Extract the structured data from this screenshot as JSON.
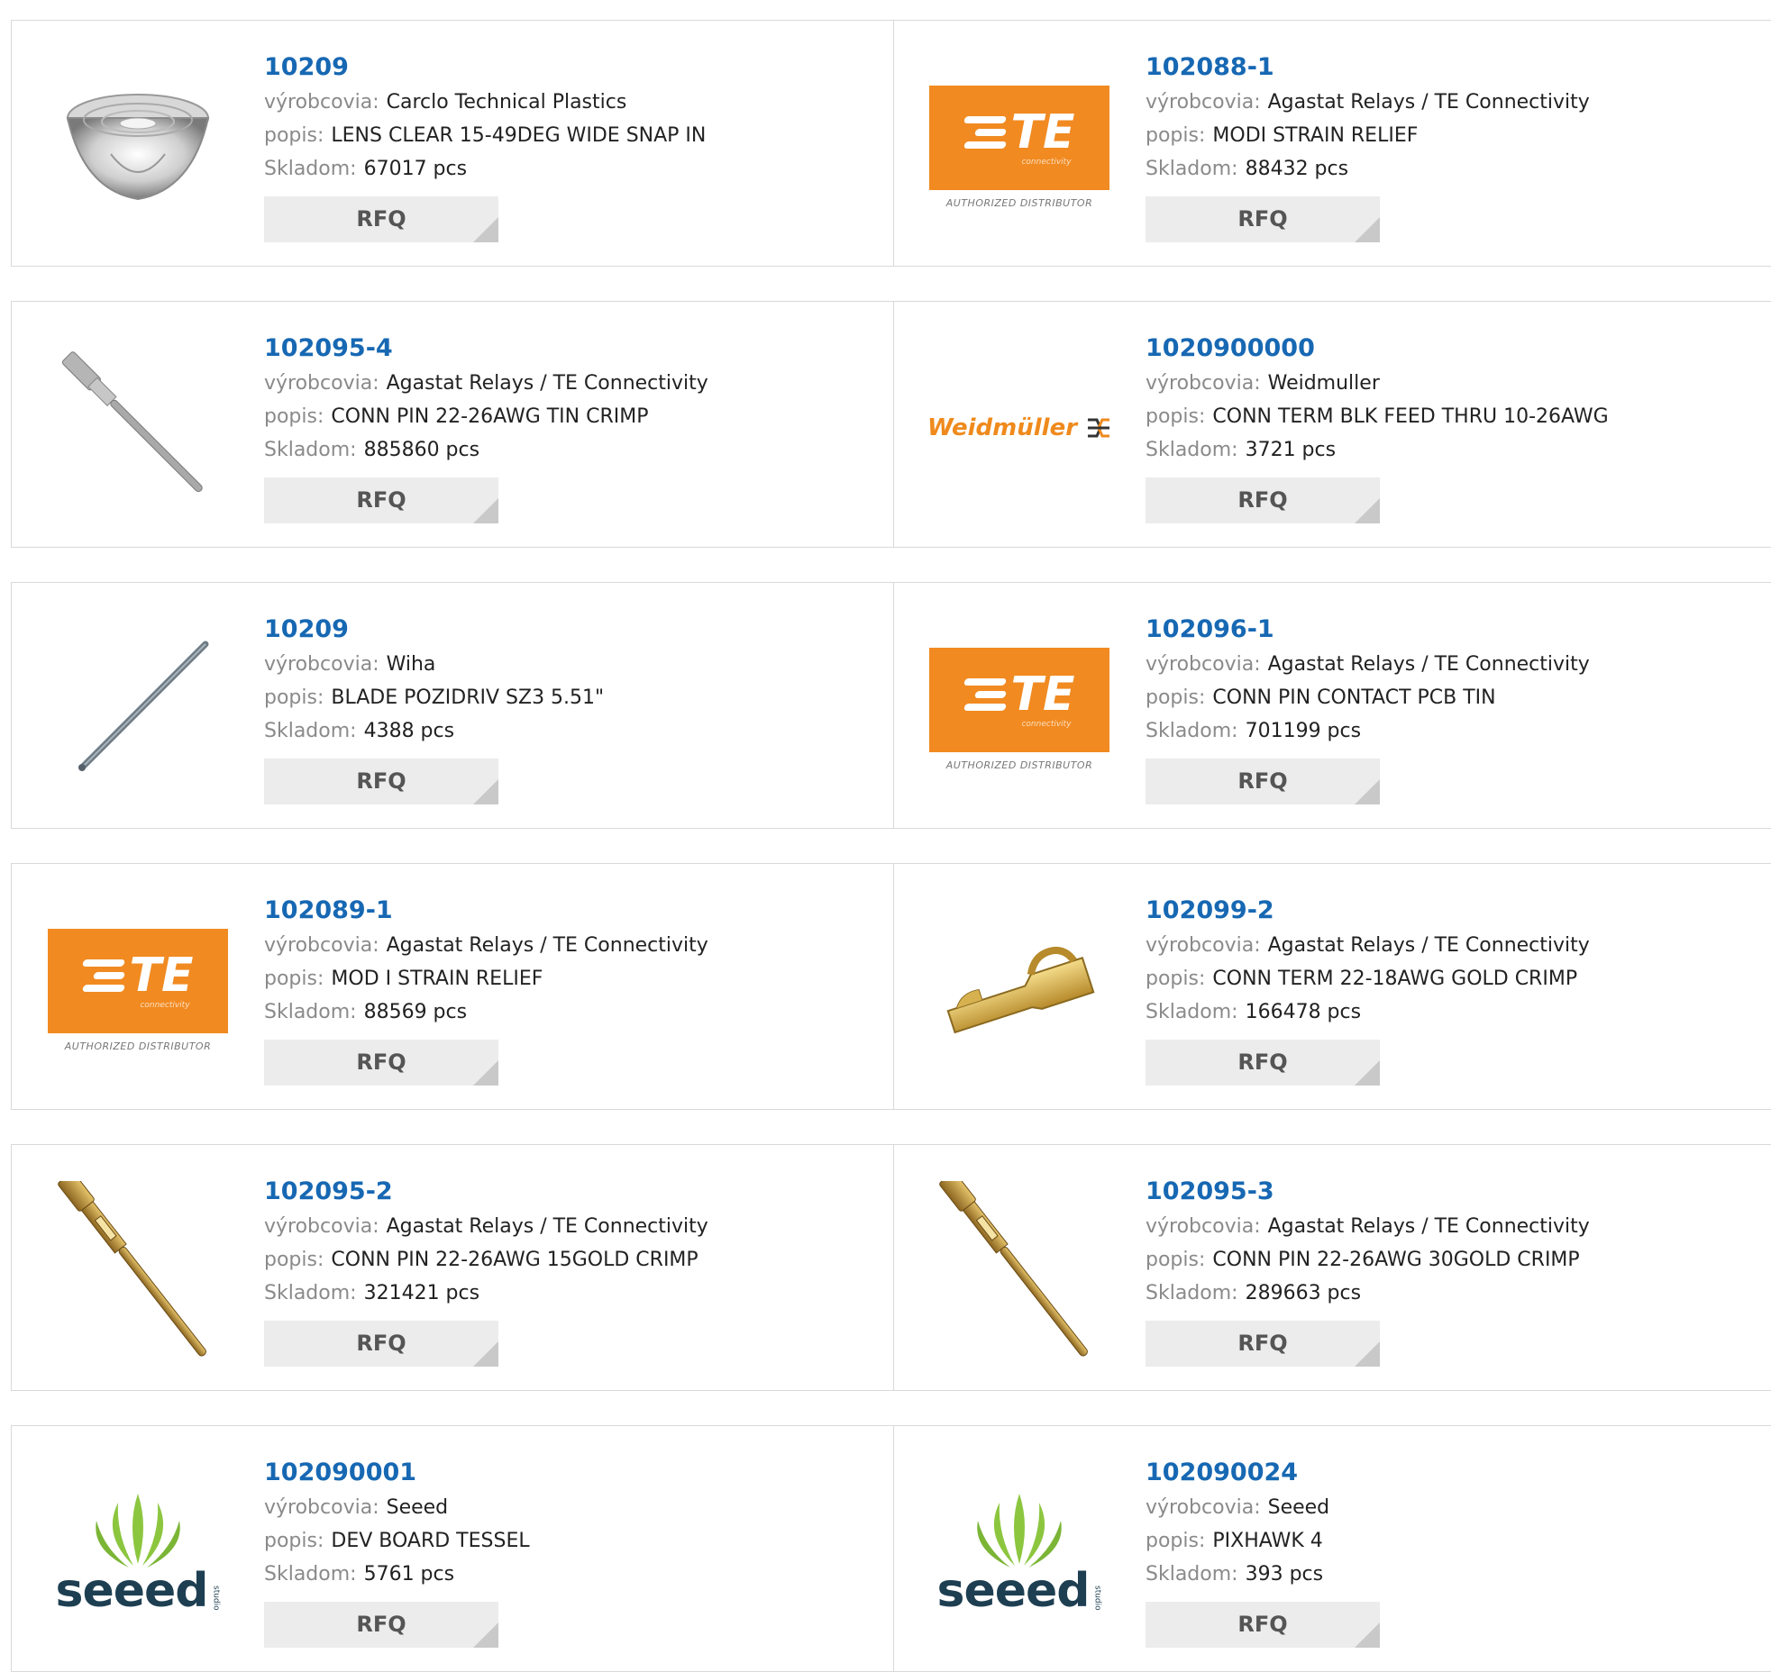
{
  "labels": {
    "manufacturer": "výrobcovia:",
    "description": "popis:",
    "stock": "Skladom:",
    "rfq": "RFQ"
  },
  "colors": {
    "part_link": "#1768b3",
    "te_orange": "#f18a21",
    "seeed_green": "#8cc63f",
    "seeed_navy": "#1e3f52"
  },
  "logos": {
    "te": {
      "name": "TE",
      "sub": "connectivity",
      "tagline": "AUTHORIZED DISTRIBUTOR"
    },
    "weidmuller": {
      "name": "Weidmüller"
    },
    "seeed": {
      "name": "seeed",
      "sub": "studio"
    }
  },
  "products": [
    {
      "part": "10209",
      "manufacturer": "Carclo Technical Plastics",
      "description": "LENS CLEAR 15-49DEG WIDE SNAP IN",
      "stock": "67017 pcs",
      "image": "lens-image"
    },
    {
      "part": "102088-1",
      "manufacturer": "Agastat Relays / TE Connectivity",
      "description": "MODI STRAIN RELIEF",
      "stock": "88432 pcs",
      "image": "te-logo"
    },
    {
      "part": "102095-4",
      "manufacturer": "Agastat Relays / TE Connectivity",
      "description": "CONN PIN 22-26AWG TIN CRIMP",
      "stock": "885860 pcs",
      "image": "silver-pin-image"
    },
    {
      "part": "1020900000",
      "manufacturer": "Weidmuller",
      "description": "CONN TERM BLK FEED THRU 10-26AWG",
      "stock": "3721 pcs",
      "image": "weidmuller-logo"
    },
    {
      "part": "10209",
      "manufacturer": "Wiha",
      "description": "BLADE POZIDRIV SZ3 5.51\"",
      "stock": "4388 pcs",
      "image": "screwdriver-blade-image"
    },
    {
      "part": "102096-1",
      "manufacturer": "Agastat Relays / TE Connectivity",
      "description": "CONN PIN CONTACT PCB TIN",
      "stock": "701199 pcs",
      "image": "te-logo"
    },
    {
      "part": "102089-1",
      "manufacturer": "Agastat Relays / TE Connectivity",
      "description": "MOD I STRAIN RELIEF",
      "stock": "88569 pcs",
      "image": "te-logo"
    },
    {
      "part": "102099-2",
      "manufacturer": "Agastat Relays / TE Connectivity",
      "description": "CONN TERM 22-18AWG GOLD CRIMP",
      "stock": "166478 pcs",
      "image": "gold-terminal-image"
    },
    {
      "part": "102095-2",
      "manufacturer": "Agastat Relays / TE Connectivity",
      "description": "CONN PIN 22-26AWG 15GOLD CRIMP",
      "stock": "321421 pcs",
      "image": "gold-pin-image"
    },
    {
      "part": "102095-3",
      "manufacturer": "Agastat Relays / TE Connectivity",
      "description": "CONN PIN 22-26AWG 30GOLD CRIMP",
      "stock": "289663 pcs",
      "image": "gold-pin-image"
    },
    {
      "part": "102090001",
      "manufacturer": "Seeed",
      "description": "DEV BOARD TESSEL",
      "stock": "5761 pcs",
      "image": "seeed-logo"
    },
    {
      "part": "102090024",
      "manufacturer": "Seeed",
      "description": "PIXHAWK 4",
      "stock": "393 pcs",
      "image": "seeed-logo"
    }
  ]
}
